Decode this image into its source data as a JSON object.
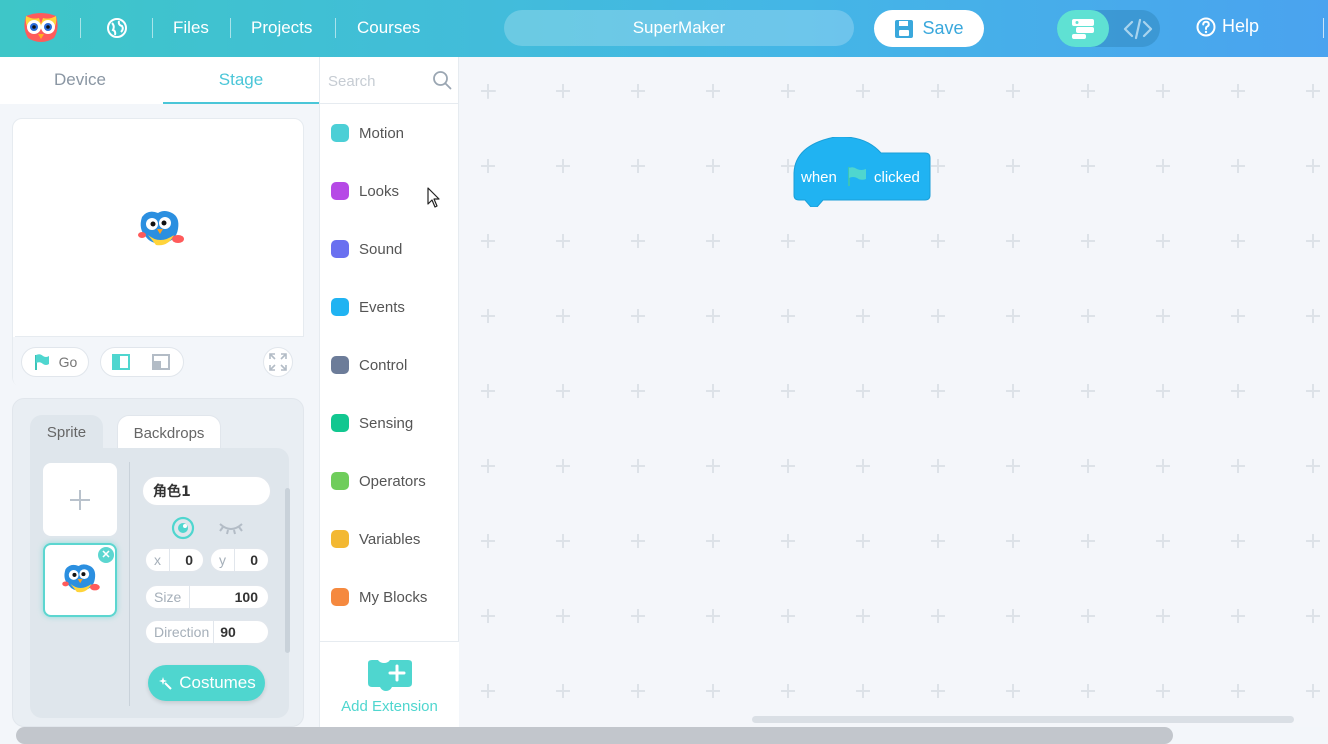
{
  "header": {
    "nav": [
      "Files",
      "Projects",
      "Courses"
    ],
    "project_name": "SuperMaker",
    "save_label": "Save",
    "help_label": "Help",
    "icons": [
      "owl-logo-icon",
      "globe-icon",
      "save-icon",
      "blocks-mode-icon",
      "code-mode-icon",
      "help-icon"
    ]
  },
  "left_tabs": [
    "Device",
    "Stage"
  ],
  "active_left_tab": "Stage",
  "stage": {
    "go_label": "Go"
  },
  "sprite_panel": {
    "tabs": [
      "Sprite",
      "Backdrops"
    ],
    "sprite_name": "角色1",
    "x_label": "x",
    "x": "0",
    "y_label": "y",
    "y": "0",
    "size_label": "Size",
    "size": "100",
    "direction_label": "Direction",
    "direction": "90",
    "costumes_label": "Costumes"
  },
  "categories": {
    "search_placeholder": "Search",
    "items": [
      {
        "name": "Motion",
        "color": "#4ccfd6"
      },
      {
        "name": "Looks",
        "color": "#b649e6"
      },
      {
        "name": "Sound",
        "color": "#6a70f0"
      },
      {
        "name": "Events",
        "color": "#20b3f2"
      },
      {
        "name": "Control",
        "color": "#6c7c99"
      },
      {
        "name": "Sensing",
        "color": "#12c790"
      },
      {
        "name": "Operators",
        "color": "#6fcd5b"
      },
      {
        "name": "Variables",
        "color": "#f3b832"
      },
      {
        "name": "My Blocks",
        "color": "#f5893f"
      }
    ],
    "add_extension_label": "Add Extension"
  },
  "workspace": {
    "hat_block": {
      "word1": "when",
      "word2": "clicked",
      "color": "#20b3f2"
    }
  }
}
